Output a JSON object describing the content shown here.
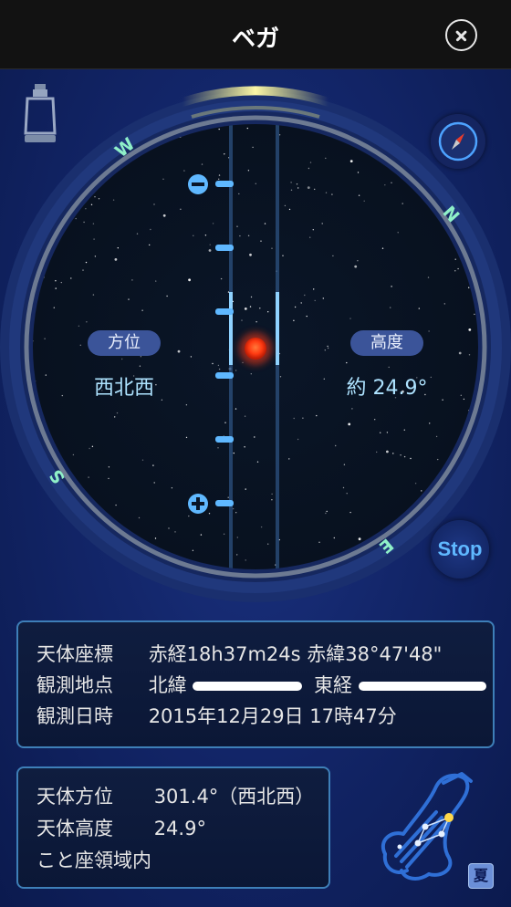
{
  "header": {
    "title": "ベガ"
  },
  "dial": {
    "directions": {
      "north": "N",
      "east": "E",
      "south": "S",
      "west": "W"
    },
    "azimuth_label": "方位",
    "azimuth_value": "西北西",
    "altitude_label": "高度",
    "altitude_value": "約 24.9°",
    "stop_label": "Stop",
    "zoom_out_symbol": "−",
    "zoom_in_symbol": "+"
  },
  "info": {
    "coords": {
      "label": "天体座標",
      "value": "赤経18h37m24s 赤緯38°47'48\""
    },
    "location": {
      "label": "観測地点",
      "lat_prefix": "北緯",
      "lon_prefix": "東経"
    },
    "datetime": {
      "label": "観測日時",
      "value": "2015年12月29日 17時47分"
    }
  },
  "object": {
    "azimuth_label": "天体方位",
    "azimuth_value": "301.4°（西北西）",
    "altitude_label": "天体高度",
    "altitude_value": "24.9°",
    "constellation": "こと座領域内"
  },
  "season_badge": "夏",
  "colors": {
    "accent": "#5fb8ff",
    "star_dot": "#ff3b12",
    "compass_letter": "#8ff0c8",
    "arc_glow": "#f6f07a"
  }
}
